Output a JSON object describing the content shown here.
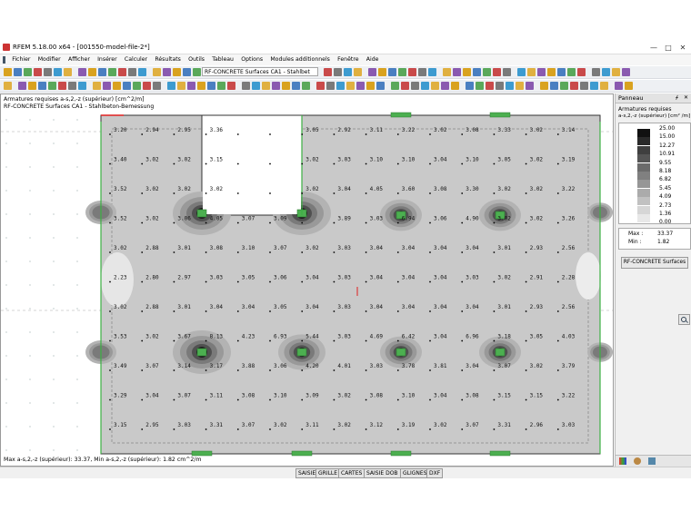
{
  "window": {
    "title": "RFEM 5.18.00 x64 - [001550-model-file-2*]",
    "min_symbol": "—",
    "max_symbol": "□",
    "close_symbol": "✕"
  },
  "menu": [
    "Fichier",
    "Modifier",
    "Afficher",
    "Insérer",
    "Calculer",
    "Résultats",
    "Outils",
    "Tableau",
    "Options",
    "Modules additionnels",
    "Fenêtre",
    "Aide"
  ],
  "toolbar": {
    "module_selector": "RF-CONCRETE Surfaces CA1 - Stahlbet"
  },
  "canvas": {
    "header_line1": "Armatures requises a-s,2,-z (supérieur) [cm^2/m]",
    "header_line2": "RF-CONCRETE Surfaces CA1 - Stahlbeton-Bemessung",
    "footer": "Max a-s,2,-z (supérieur): 33.37, Min a-s,2,-z (supérieur): 1.82 cm^2/m",
    "grid_values": [
      [
        "3.20",
        "2.94",
        "2.95",
        "3.36",
        "",
        "",
        "3.05",
        "2.92",
        "3.11",
        "3.22",
        "3.02",
        "3.08",
        "3.33",
        "3.02",
        "3.14"
      ],
      [
        "3.40",
        "3.02",
        "3.02",
        "3.15",
        "",
        "",
        "3.02",
        "3.03",
        "3.10",
        "3.10",
        "3.04",
        "3.10",
        "3.05",
        "3.02",
        "3.19"
      ],
      [
        "3.52",
        "3.02",
        "3.02",
        "3.02",
        "",
        "",
        "3.02",
        "3.04",
        "4.05",
        "3.60",
        "3.08",
        "3.30",
        "3.02",
        "3.02",
        "3.22"
      ],
      [
        "3.52",
        "3.02",
        "3.06",
        "4.05",
        "3.07",
        "3.09",
        "",
        "3.89",
        "3.03",
        "6.94",
        "3.06",
        "4.90",
        "3.02",
        "3.02",
        "3.26"
      ],
      [
        "3.02",
        "2.88",
        "3.01",
        "3.08",
        "3.10",
        "3.07",
        "3.02",
        "3.03",
        "3.04",
        "3.04",
        "3.04",
        "3.04",
        "3.01",
        "2.93",
        "2.56"
      ],
      [
        "2.23",
        "2.80",
        "2.97",
        "3.03",
        "3.05",
        "3.06",
        "3.04",
        "3.03",
        "3.04",
        "3.04",
        "3.04",
        "3.03",
        "3.02",
        "2.91",
        "2.28"
      ],
      [
        "3.02",
        "2.88",
        "3.01",
        "3.04",
        "3.04",
        "3.05",
        "3.04",
        "3.03",
        "3.04",
        "3.04",
        "3.04",
        "3.04",
        "3.01",
        "2.93",
        "2.56"
      ],
      [
        "3.53",
        "3.02",
        "3.67",
        "8.13",
        "4.23",
        "6.93",
        "5.44",
        "3.03",
        "4.69",
        "6.42",
        "3.04",
        "6.96",
        "3.18",
        "3.05",
        "4.03"
      ],
      [
        "3.49",
        "3.07",
        "3.14",
        "3.17",
        "3.88",
        "3.06",
        "4.20",
        "4.01",
        "3.03",
        "3.78",
        "3.81",
        "3.04",
        "3.07",
        "3.02",
        "3.79"
      ],
      [
        "3.29",
        "3.04",
        "3.07",
        "3.11",
        "3.08",
        "3.10",
        "3.09",
        "3.02",
        "3.08",
        "3.10",
        "3.04",
        "3.08",
        "3.15",
        "3.15",
        "3.22"
      ],
      [
        "3.15",
        "2.95",
        "3.03",
        "3.31",
        "3.07",
        "3.02",
        "3.11",
        "3.02",
        "3.12",
        "3.19",
        "3.02",
        "3.07",
        "3.31",
        "2.96",
        "3.03"
      ]
    ]
  },
  "panel": {
    "title": "Panneau",
    "pin_symbol": "ᚋ",
    "close_symbol": "✕",
    "legend_title": "Armatures requises",
    "legend_subtitle": "a-s,2,-z (supérieur) [cm² /m]",
    "legend_values": [
      "25.00",
      "15.00",
      "12.27",
      "10.91",
      "9.55",
      "8.18",
      "6.82",
      "5.45",
      "4.09",
      "2.73",
      "1.36",
      "0.00"
    ],
    "legend_colors": [
      "#111111",
      "#2a2a2a",
      "#3f3f3f",
      "#555555",
      "#6b6b6b",
      "#808080",
      "#969696",
      "#ababab",
      "#c1c1c1",
      "#d6d6d6",
      "#e8e8e8",
      "#ffffff"
    ],
    "max_label": "Max :",
    "max_value": "33.37",
    "min_label": "Min :",
    "min_value": "1.82",
    "module_button": "RF-CONCRETE Surfaces"
  },
  "statusbar": {
    "tabs": [
      "SAISIE",
      "GRILLE",
      "CARTES",
      "SAISIE DOB",
      "GLIGNES",
      "DXF"
    ]
  }
}
